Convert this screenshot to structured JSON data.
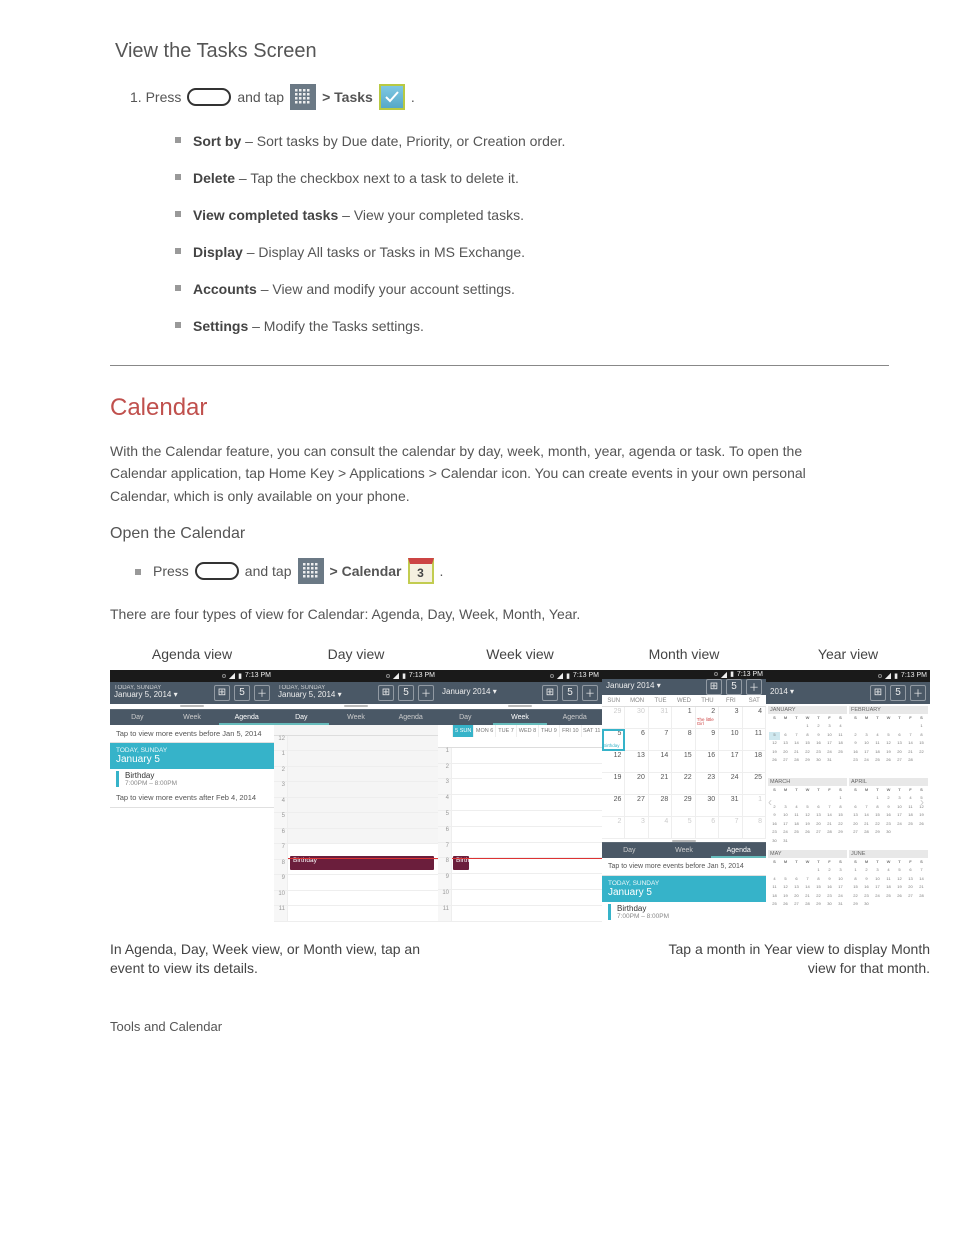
{
  "page": {
    "title": "View the Tasks Screen",
    "step_prefix": "1. Press",
    "step_mid1": "and tap",
    "step_mid2": "> Tasks",
    "step_period": ".",
    "menu_items": [
      {
        "label": "Sort by",
        "desc": "– Sort tasks by Due date, Priority, or Creation order."
      },
      {
        "label": "Delete",
        "desc": "– Tap the checkbox next to a task to delete it."
      },
      {
        "label": "View completed tasks",
        "desc": "– View your completed tasks."
      },
      {
        "label": "Display",
        "desc": "– Display All tasks or Tasks in MS Exchange."
      },
      {
        "label": "Accounts",
        "desc": "– View and modify your account settings."
      },
      {
        "label": "Settings",
        "desc": "– Modify the Tasks settings."
      }
    ],
    "calendar_heading": "Calendar",
    "calendar_intro": "With the Calendar feature, you can consult the calendar by day, week, month, year, agenda or task. To open the Calendar application, tap Home Key > Applications > Calendar icon. You can create events in your own personal Calendar, which is only available on your phone.",
    "open_heading": "Open the Calendar",
    "open_prefix": "Press",
    "open_mid1": "and tap",
    "open_label": "> Calendar",
    "open_period": ".",
    "views_intro": "There are four types of view for Calendar: Agenda, Day, Week, Month, Year.",
    "shots": {
      "statusbar_time": "7:13 PM",
      "agenda": {
        "label": "Agenda view",
        "title_sub": "TODAY, SUNDAY",
        "title": "January 5, 2014",
        "tabs": [
          "Day",
          "Week",
          "Agenda"
        ],
        "active_tab": 2,
        "before": "Tap to view more events before Jan 5, 2014",
        "head_sub": "TODAY, SUNDAY",
        "head_main": "January 5",
        "evt_name": "Birthday",
        "evt_time": "7:00PM – 8:00PM",
        "after": "Tap to view more events after Feb 4, 2014"
      },
      "day": {
        "label": "Day view",
        "title_sub": "TODAY, SUNDAY",
        "title": "January 5, 2014",
        "tabs": [
          "Day",
          "Week",
          "Agenda"
        ],
        "active_tab": 0,
        "hours": [
          "12",
          "1",
          "2",
          "3",
          "4",
          "5",
          "6",
          "7",
          "8",
          "9",
          "10",
          "11"
        ],
        "evt": "Birthday"
      },
      "week": {
        "label": "Week view",
        "title": "January 2014",
        "tabs": [
          "Day",
          "Week",
          "Agenda"
        ],
        "active_tab": 1,
        "wdays": [
          "5 SUN",
          "MON 6",
          "TUE 7",
          "WED 8",
          "THU 9",
          "FRI 10",
          "SAT 11"
        ],
        "hours": [
          "",
          "1",
          "2",
          "3",
          "4",
          "5",
          "6",
          "7",
          "8",
          "9",
          "10",
          "11"
        ],
        "evt": "Birthda"
      },
      "month": {
        "label": "Month view",
        "title": "January 2014",
        "tabs": [
          "Day",
          "Week",
          "Agenda"
        ],
        "active_tab": 2,
        "wdays": [
          "SUN",
          "MON",
          "TUE",
          "WED",
          "THU",
          "FRI",
          "SAT"
        ],
        "bottom": {
          "before": "Tap to view more events before Jan 5, 2014",
          "head_sub": "TODAY, SUNDAY",
          "head_main": "January 5",
          "evt_name": "Birthday",
          "evt_time": "7:00PM – 8:00PM"
        }
      },
      "year": {
        "label": "Year view",
        "title": "2014",
        "months": [
          "JANUARY",
          "FEBRUARY",
          "MARCH",
          "APRIL",
          "MAY",
          "JUNE"
        ]
      }
    },
    "cap_left": "In Agenda, Day, Week view, or Month view, tap an event to view its details.",
    "cap_right": "Tap a month in Year view to display Month view for that month.",
    "footer": "Tools and Calendar"
  },
  "chart_data": null
}
